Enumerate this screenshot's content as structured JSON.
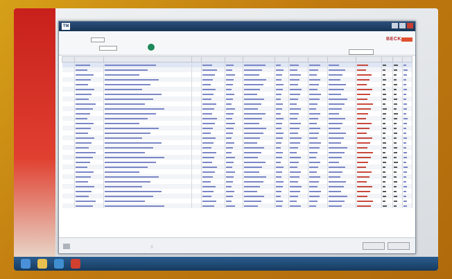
{
  "window": {
    "app_badge": "TM",
    "title_lines": [
      "",
      ""
    ]
  },
  "header": {
    "fields": [
      {
        "label": "",
        "value": ""
      },
      {
        "label": "",
        "value": ""
      }
    ],
    "brand": "BECK"
  },
  "table": {
    "columns": [
      "",
      "",
      "",
      "",
      "",
      "",
      "",
      "",
      "",
      "",
      "",
      "",
      "",
      "",
      ""
    ],
    "rows": 30
  },
  "footer": {
    "notice_icon": "info-icon",
    "button_labels": [
      "",
      ""
    ]
  },
  "taskbar": {
    "icons": [
      "start-icon",
      "explorer-icon",
      "browser-icon",
      "app-icon"
    ]
  }
}
